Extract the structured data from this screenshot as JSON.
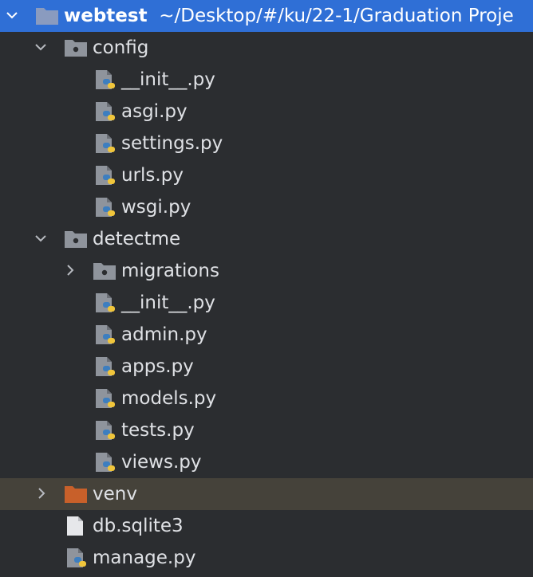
{
  "project": {
    "name": "webtest",
    "path": "~/Desktop/#/ku/22-1/Graduation Proje",
    "chevron": "chevron-down-icon",
    "icon": "folder-icon"
  },
  "items": [
    {
      "label": "config",
      "icon": "source-folder-icon",
      "chevron": "chevron-down-icon"
    },
    {
      "label": "__init__.py",
      "icon": "python-file-icon"
    },
    {
      "label": "asgi.py",
      "icon": "python-file-icon"
    },
    {
      "label": "settings.py",
      "icon": "python-file-icon"
    },
    {
      "label": "urls.py",
      "icon": "python-file-icon"
    },
    {
      "label": "wsgi.py",
      "icon": "python-file-icon"
    },
    {
      "label": "detectme",
      "icon": "source-folder-icon",
      "chevron": "chevron-down-icon"
    },
    {
      "label": "migrations",
      "icon": "source-folder-icon",
      "chevron": "chevron-right-icon"
    },
    {
      "label": "__init__.py",
      "icon": "python-file-icon"
    },
    {
      "label": "admin.py",
      "icon": "python-file-icon"
    },
    {
      "label": "apps.py",
      "icon": "python-file-icon"
    },
    {
      "label": "models.py",
      "icon": "python-file-icon"
    },
    {
      "label": "tests.py",
      "icon": "python-file-icon"
    },
    {
      "label": "views.py",
      "icon": "python-file-icon"
    },
    {
      "label": "venv",
      "icon": "excluded-folder-icon",
      "chevron": "chevron-right-icon"
    },
    {
      "label": "db.sqlite3",
      "icon": "text-file-icon"
    },
    {
      "label": "manage.py",
      "icon": "python-file-icon"
    }
  ],
  "colors": {
    "background": "#2b2d30",
    "selection": "#2f6fd6",
    "highlight_row": "#45423a",
    "text": "#dfe1e5",
    "folder_gray": "#8f949c",
    "folder_excluded": "#c8602a",
    "python_blue": "#3d7ebf",
    "python_yellow": "#f0c53b"
  }
}
